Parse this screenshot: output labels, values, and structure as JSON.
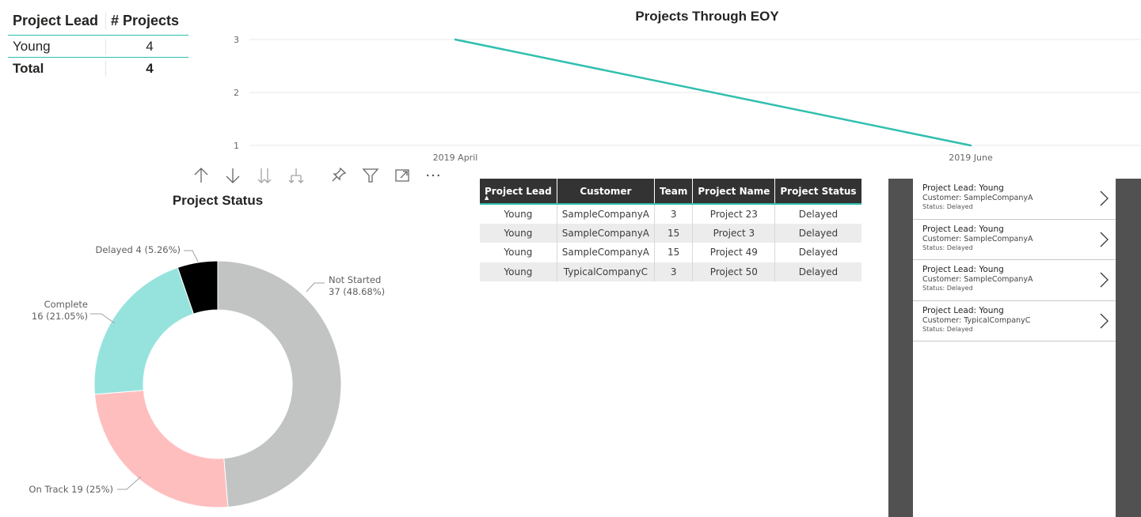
{
  "summary_table": {
    "headers": [
      "Project Lead",
      "# Projects"
    ],
    "rows": [
      {
        "lead": "Young",
        "count": "4"
      }
    ],
    "total": {
      "label": "Total",
      "count": "4"
    },
    "accent": "#2fbfae"
  },
  "toolbar": {
    "icons": [
      "sort-up-icon",
      "sort-down-icon",
      "expand-all-down-icon",
      "drill-down-icon",
      "pin-icon",
      "filter-icon",
      "focus-mode-icon",
      "more-options-icon"
    ],
    "more_label": "···"
  },
  "line_chart": {
    "chart_data": {
      "type": "line",
      "title": "Projects Through EOY",
      "x": [
        "2019 April",
        "2019 June"
      ],
      "series": [
        {
          "values": [
            3,
            1
          ],
          "color": "#2fbfae"
        }
      ],
      "yticks": [
        "1",
        "2",
        "3"
      ],
      "ylim": [
        1,
        3
      ],
      "grid": true
    }
  },
  "donut_chart": {
    "chart_data": {
      "type": "pie",
      "title": "Project Status",
      "slices": [
        {
          "name": "Not Started",
          "value": 37,
          "label_a": "Not Started",
          "label_b": "37 (48.68%)",
          "color": "#c2c4c4"
        },
        {
          "name": "On Track",
          "value": 19,
          "label_a": "On Track 19 (25%)",
          "label_b": "",
          "color": "#ffbebe"
        },
        {
          "name": "Complete",
          "value": 16,
          "label_a": "Complete",
          "label_b": "16 (21.05%)",
          "color": "#96e3de"
        },
        {
          "name": "Delayed",
          "value": 4,
          "label_a": "Delayed 4 (5.26%)",
          "label_b": "",
          "color": "#000000"
        }
      ]
    }
  },
  "detail_table": {
    "headers": [
      "Project Lead",
      "Customer",
      "Team",
      "Project Name",
      "Project Status"
    ],
    "sort_indicator": "▲",
    "rows": [
      [
        "Young",
        "SampleCompanyA",
        "3",
        "Project 23",
        "Delayed"
      ],
      [
        "Young",
        "SampleCompanyA",
        "15",
        "Project 3",
        "Delayed"
      ],
      [
        "Young",
        "SampleCompanyA",
        "15",
        "Project 49",
        "Delayed"
      ],
      [
        "Young",
        "TypicalCompanyC",
        "3",
        "Project 50",
        "Delayed"
      ]
    ]
  },
  "card_list": {
    "cards": [
      {
        "lead": "Project Lead: Young",
        "customer": "Customer: SampleCompanyA",
        "status": "Status: Delayed"
      },
      {
        "lead": "Project Lead: Young",
        "customer": "Customer: SampleCompanyA",
        "status": "Status: Delayed"
      },
      {
        "lead": "Project Lead: Young",
        "customer": "Customer: SampleCompanyA",
        "status": "Status: Delayed"
      },
      {
        "lead": "Project Lead: Young",
        "customer": "Customer: TypicalCompanyC",
        "status": "Status: Delayed"
      }
    ]
  }
}
